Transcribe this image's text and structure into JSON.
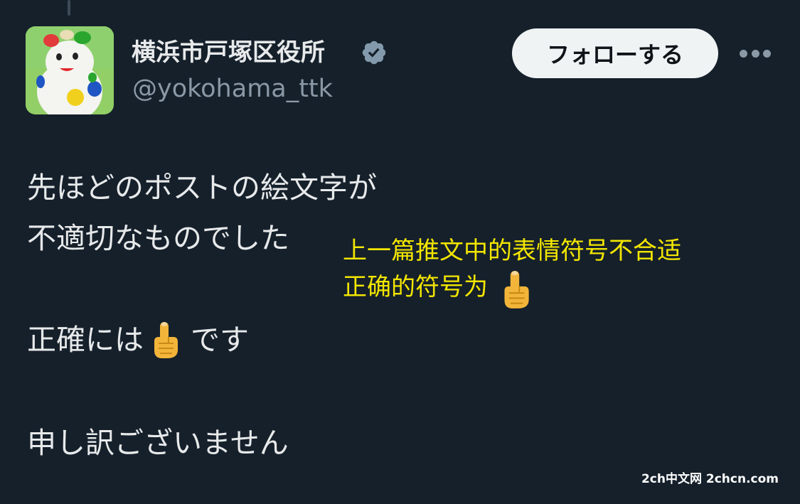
{
  "profile": {
    "display_name": "横浜市戸塚区役所",
    "handle": "@yokohama_ttk",
    "follow_label": "フォローする"
  },
  "tweet": {
    "line1": "先ほどのポストの絵文字が",
    "line2": "不適切なものでした",
    "line3_before": "正確には",
    "line3_after": "です",
    "line4": "申し訳ございません"
  },
  "caption": {
    "line1": "上一篇推文中的表情符号不合适",
    "line2": "正确的符号为"
  },
  "watermark": "2ch中文网 2chcn.com",
  "icons": {
    "verified": "verified-badge-icon",
    "more": "more-options-icon",
    "emoji": "index-pointing-up-emoji"
  },
  "colors": {
    "background": "#15202b",
    "text": "#e7e9ea",
    "secondary_text": "#8b98a5",
    "caption": "#f3e600",
    "follow_button_bg": "#eff3f4"
  }
}
